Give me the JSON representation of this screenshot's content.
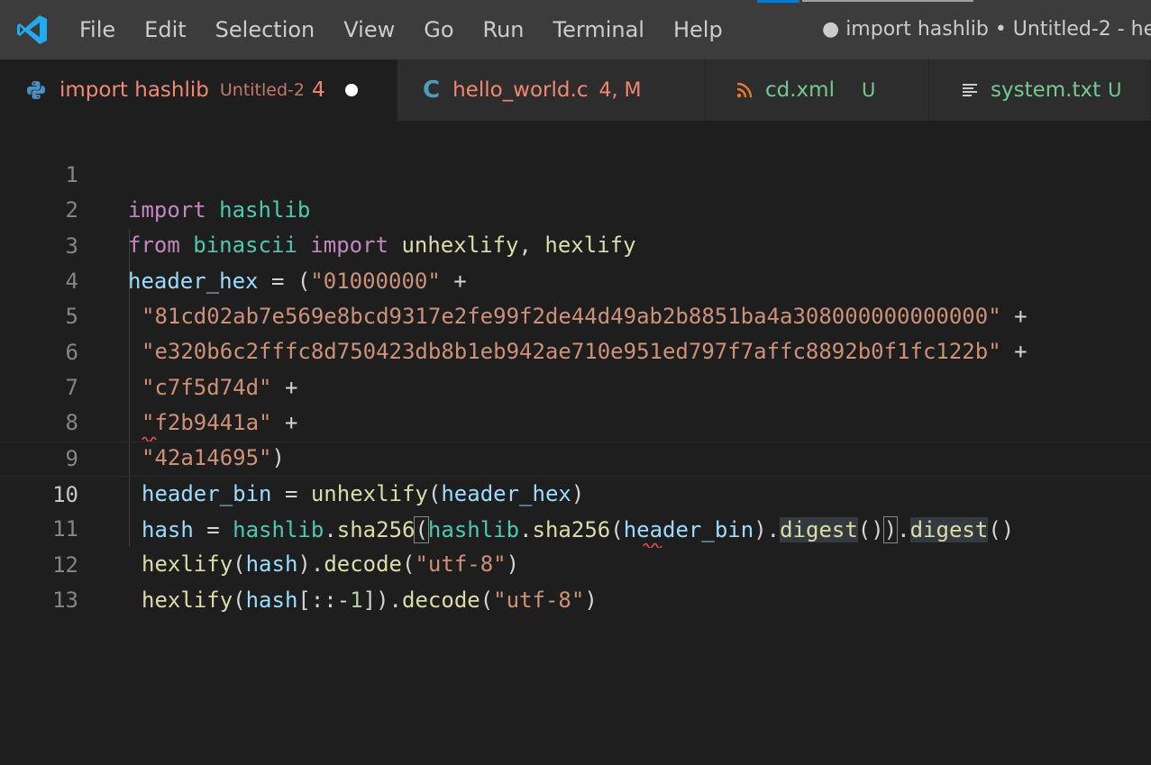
{
  "titlebar": {
    "menu": [
      "File",
      "Edit",
      "Selection",
      "View",
      "Go",
      "Run",
      "Terminal",
      "Help"
    ],
    "window_title": "● import hashlib • Untitled-2 - he"
  },
  "tabs": [
    {
      "name": "import hashlib",
      "desc": "Untitled-2",
      "status": "4",
      "icon": "python-icon",
      "color": "#f48771"
    },
    {
      "name": "hello_world.c",
      "desc": "",
      "status": "4, M",
      "icon": "c-file-icon",
      "color": "#f48771"
    },
    {
      "name": "cd.xml",
      "desc": "",
      "status": "U",
      "icon": "rss-icon",
      "color": "#73c991"
    },
    {
      "name": "system.txt",
      "desc": "",
      "status": "U",
      "icon": "text-file-icon",
      "color": "#73c991"
    }
  ],
  "editor": {
    "line_numbers": [
      "1",
      "2",
      "3",
      "4",
      "5",
      "6",
      "7",
      "8",
      "9",
      "10",
      "11",
      "12",
      "13"
    ],
    "current_line": 10,
    "lines": {
      "l1": [
        "import",
        " ",
        "hashlib"
      ],
      "l2": [
        "from",
        " ",
        "binascii",
        " ",
        "import",
        " ",
        "unhexlify",
        ", ",
        "hexlify"
      ],
      "l3": [
        "header_hex",
        " = (",
        "\"01000000\"",
        " +"
      ],
      "l4": [
        "\"81cd02ab7e569e8bcd9317e2fe99f2de44d49ab2b8851ba4a308000000000000\"",
        " +"
      ],
      "l5": [
        "\"e320b6c2fffc8d750423db8b1eb942ae710e951ed797f7affc8892b0f1fc122b\"",
        " +"
      ],
      "l6": [
        "\"c7f5d74d\"",
        " +"
      ],
      "l7": [
        "\"f2b9441a\"",
        " +"
      ],
      "l8": [
        "\"42a14695\"",
        ")"
      ],
      "l9": [
        "header_bin",
        " = ",
        "unhexlify",
        "(",
        "header_hex",
        ")"
      ],
      "l10": [
        "hash",
        " = ",
        "hashlib",
        ".",
        "sha256",
        "(",
        "hashlib",
        ".",
        "sha256",
        "(",
        "header_bin",
        ").",
        "digest",
        "()",
        ")",
        ".",
        "digest",
        "()"
      ],
      "l11": [
        "hexlify",
        "(",
        "hash",
        ").",
        "decode",
        "(",
        "\"utf-8\"",
        ")"
      ],
      "l12": [
        "hexlify",
        "(",
        "hash",
        "[::-",
        "1",
        "]).",
        "decode",
        "(",
        "\"utf-8\"",
        ")"
      ]
    }
  }
}
